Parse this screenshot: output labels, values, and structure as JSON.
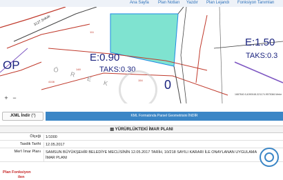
{
  "nav": {
    "items": [
      "Ana Sayfa",
      "Plan Notları",
      "Yazdır",
      "Plan Lejandı",
      "Fonksiyon Tanımları"
    ]
  },
  "map": {
    "street": "3127.Sokak",
    "labels": {
      "e_left": "E:0.90",
      "takas_left": "TAKS:0.30",
      "e_right": "E:1.50",
      "takas_right": "TAKS:0.3",
      "op": "OP",
      "ozel": "Ö R E K",
      "num": "0"
    },
    "controls": {
      "zoom_in": "+",
      "zoom_out": "−"
    },
    "scale_text": "1687840.9,4090048-321174.9573066 Metre"
  },
  "kml": {
    "button_label": ".KML İndir",
    "button_icon": "(⁰)",
    "banner": "KML Formatında Parsel Geometrisini İNDİR"
  },
  "plan": {
    "title": "YÜRÜRLÜKTEKİ İMAR PLANI",
    "rows": [
      {
        "key": "Ölçeği",
        "value": "1/1000"
      },
      {
        "key": "Tasdik Tarihi",
        "value": "12.05.2017"
      },
      {
        "key": "Mer'i İmar Planı",
        "value": "SAMSUN BÜYÜKŞEHİR BELEDİYE MECLİSİNİN 12.05.2017 TARİH, 10/218 SAYILI KARARI İLE ONAYLANAN UYGULAMA İMAR PLANI"
      }
    ],
    "function_label": "Plan Fonksiyon",
    "function_suffix": "ilen"
  },
  "colors": {
    "accent": "#3b86c6",
    "parcel_fill": "#7fe3d0",
    "plan_line": "#c0392b"
  }
}
